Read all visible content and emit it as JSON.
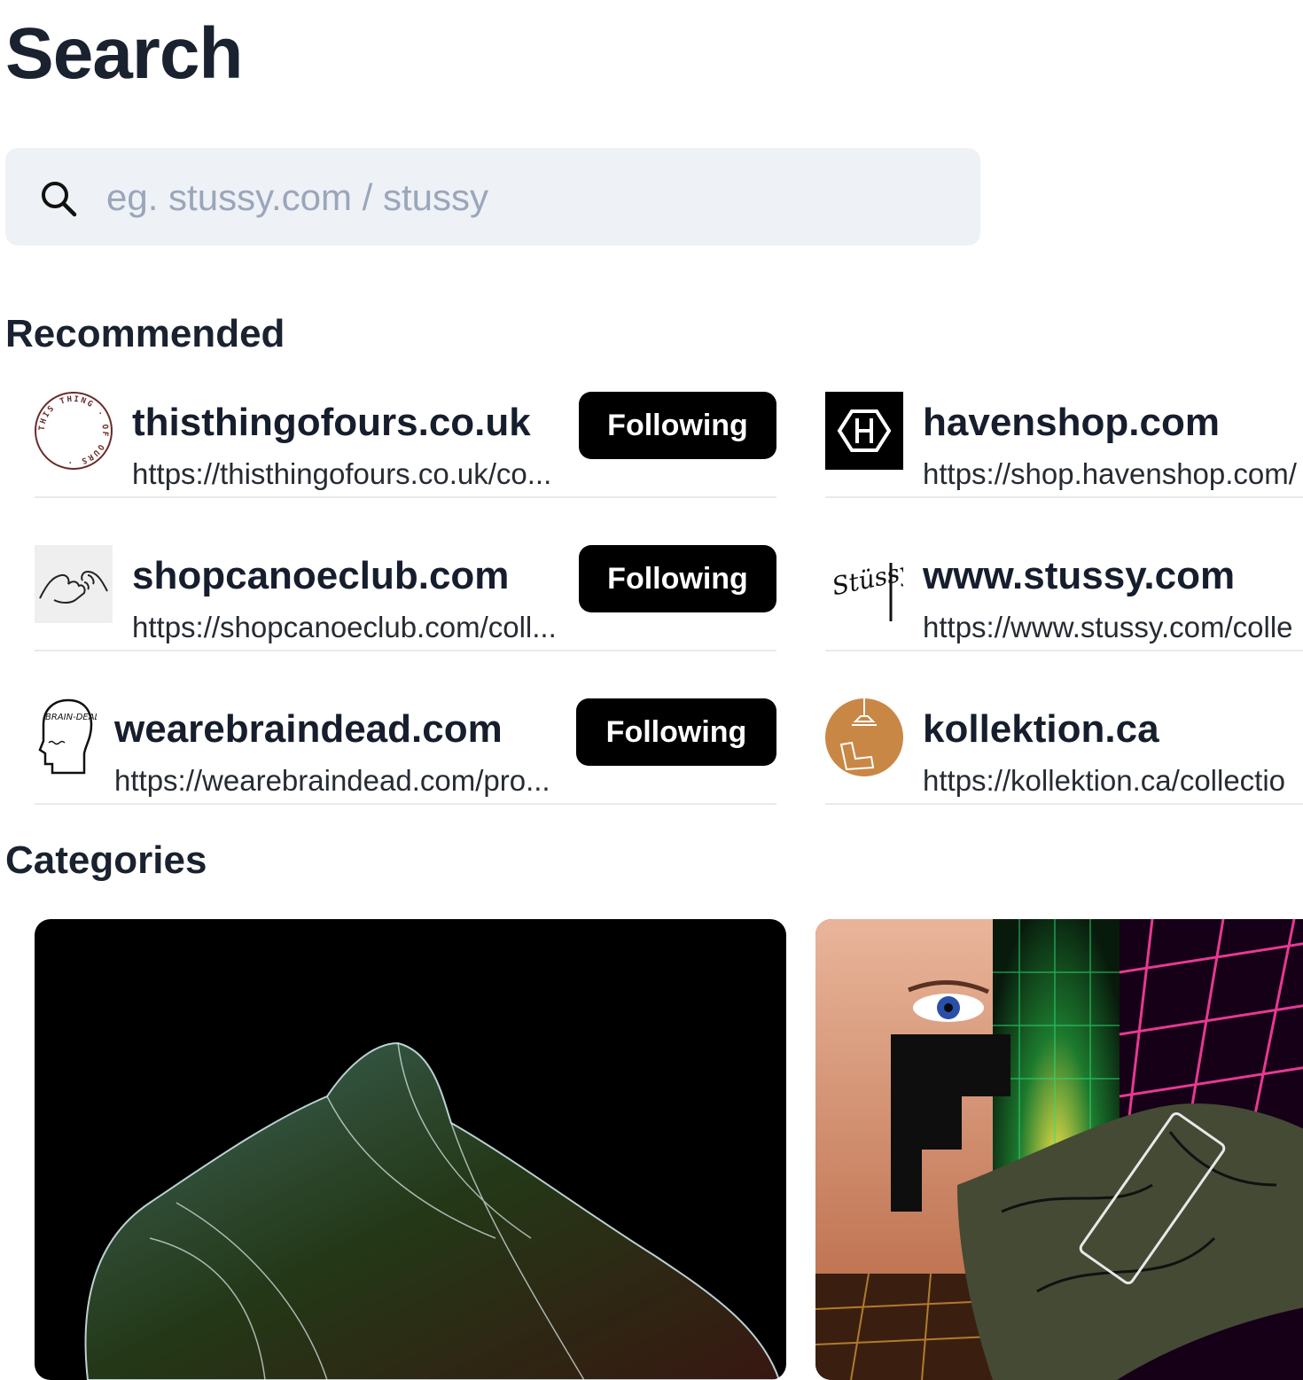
{
  "header": {
    "title": "Search"
  },
  "search": {
    "placeholder": "eg. stussy.com / stussy"
  },
  "recommended": {
    "title": "Recommended",
    "stores": [
      {
        "domain": "thisthingofours.co.uk",
        "url": "https://thisthingofours.co.uk/co...",
        "button": "Following"
      },
      {
        "domain": "havenshop.com",
        "url": "https://shop.havenshop.com/",
        "button": ""
      },
      {
        "domain": "shopcanoeclub.com",
        "url": "https://shopcanoeclub.com/coll...",
        "button": "Following"
      },
      {
        "domain": "www.stussy.com",
        "url": "https://www.stussy.com/colle",
        "button": ""
      },
      {
        "domain": "wearebraindead.com",
        "url": "https://wearebraindead.com/pro...",
        "button": "Following"
      },
      {
        "domain": "kollektion.ca",
        "url": "https://kollektion.ca/collectio",
        "button": ""
      }
    ],
    "logo_text": {
      "thisthingofours": "THIS THING · OF OURS ·",
      "braindead": "BRAIN-DEAD))",
      "stussy": "Stüssy"
    }
  },
  "categories": {
    "title": "Categories"
  },
  "colors": {
    "button_bg": "#000000",
    "search_bg": "#eef1f6",
    "kollektion_orange": "#c98746"
  }
}
